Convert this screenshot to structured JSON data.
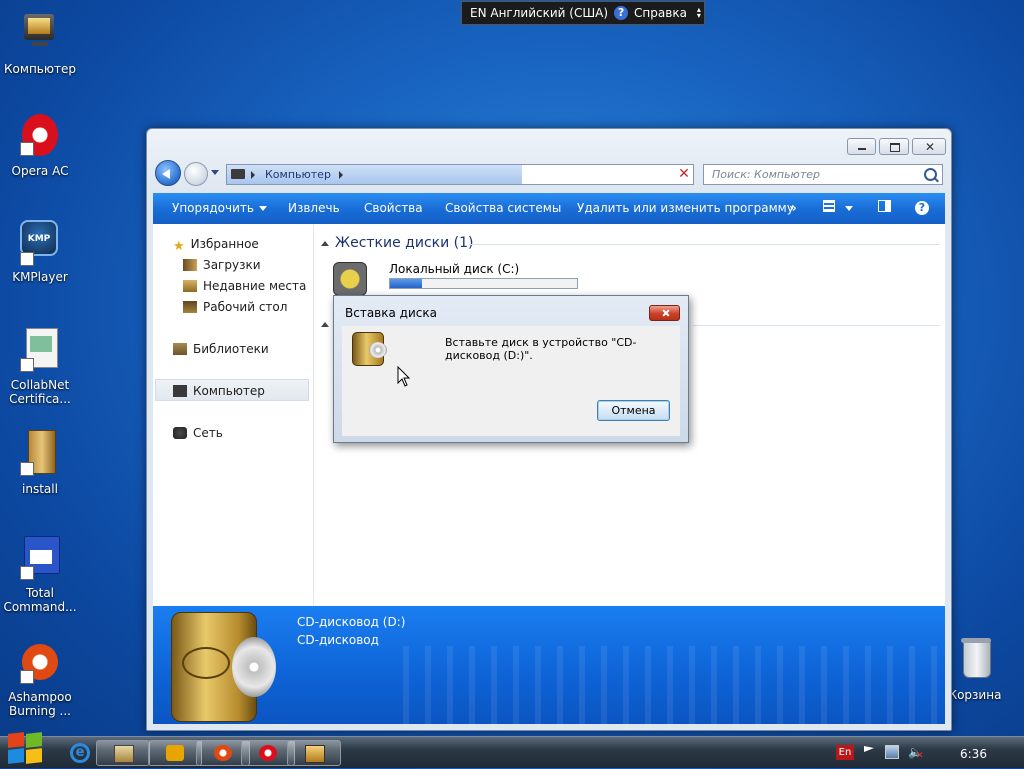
{
  "language_bar": {
    "lang": "EN Английский (США)",
    "help": "Справка"
  },
  "desktop_icons": [
    {
      "label": "Компьютер"
    },
    {
      "label": "Opera AC"
    },
    {
      "label": "KMPlayer",
      "badge": "KMP"
    },
    {
      "label": "CollabNet Certifica..."
    },
    {
      "label": "install"
    },
    {
      "label": "Total Command..."
    },
    {
      "label": "Ashampoo Burning ..."
    },
    {
      "label": "Корзина"
    }
  ],
  "explorer": {
    "address": "Компьютер",
    "search_placeholder": "Поиск: Компьютер",
    "toolbar": {
      "organize": "Упорядочить",
      "eject": "Извлечь",
      "properties": "Свойства",
      "system_properties": "Свойства системы",
      "uninstall": "Удалить или изменить программу",
      "more": "»"
    },
    "nav": {
      "favorites": "Избранное",
      "downloads": "Загрузки",
      "recent": "Недавние места",
      "desktop": "Рабочий стол",
      "libraries": "Библиотеки",
      "computer": "Компьютер",
      "network": "Сеть"
    },
    "hard_disks_header": "Жесткие диски (1)",
    "local_disk": {
      "label": "Локальный диск (C:)",
      "fill_fraction": 0.17
    },
    "details": {
      "title": "CD-дисковод (D:)",
      "subtitle": "CD-дисковод"
    }
  },
  "dialog": {
    "title": "Вставка диска",
    "message": "Вставьте диск в устройство \"CD-дисковод (D:)\".",
    "cancel": "Отмена"
  },
  "taskbar": {
    "tray_lang": "En",
    "clock": "6:36"
  },
  "colors": {
    "toolbar_blue": "#1a6ed8",
    "details_blue": "#0e63d6",
    "close_red": "#c9412a"
  }
}
